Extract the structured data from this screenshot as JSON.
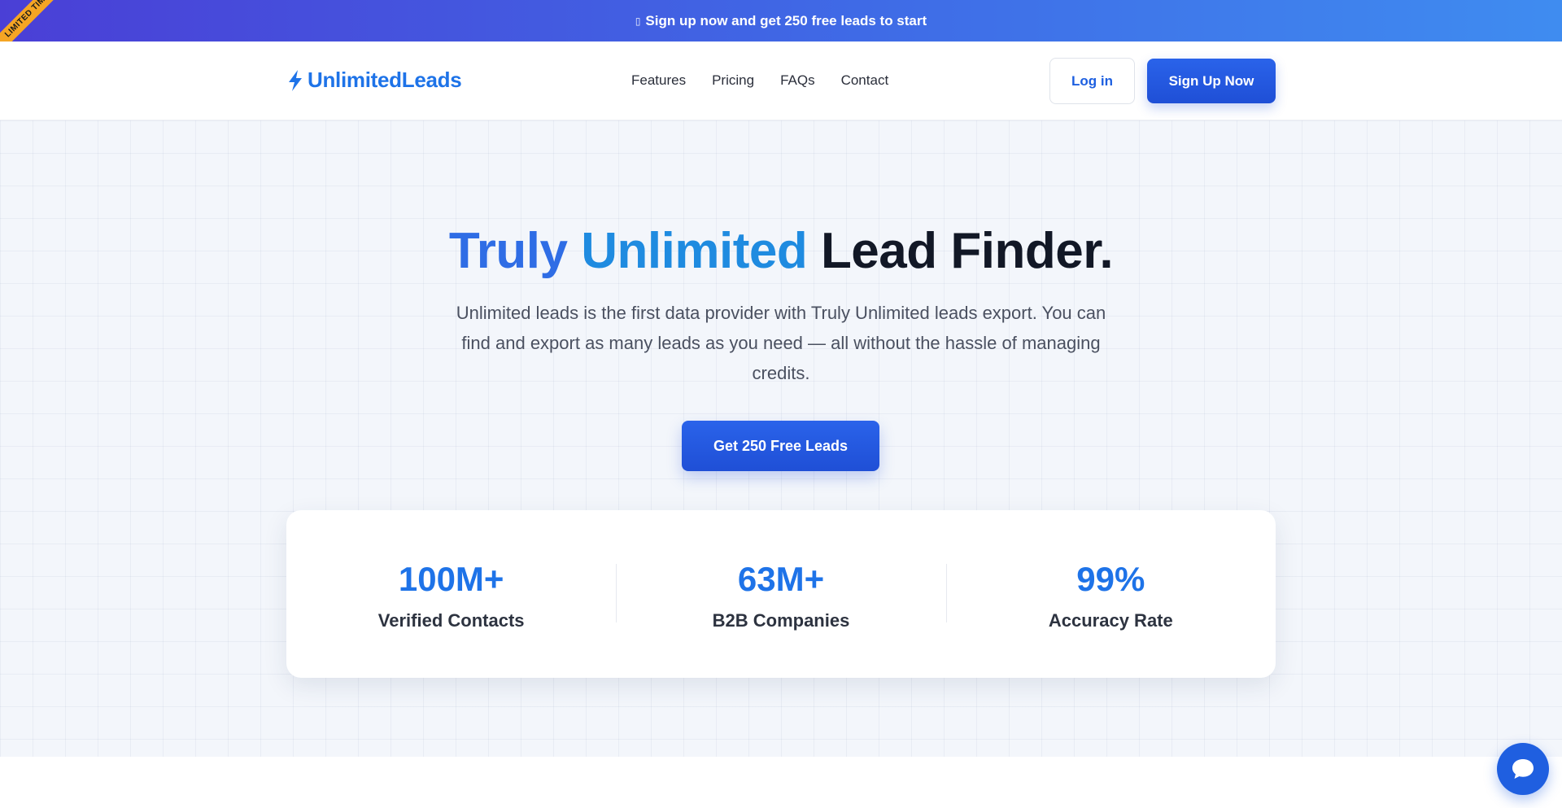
{
  "banner": {
    "ribbon_text": "LIMITED TIME",
    "promo_text": "Sign up now and get 250 free leads to start",
    "promo_icon": "gift-icon"
  },
  "nav": {
    "logo_text": "UnlimitedLeads",
    "logo_icon": "lightning-bolt-icon",
    "links": [
      "Features",
      "Pricing",
      "FAQs",
      "Contact"
    ],
    "login_label": "Log in",
    "signup_label": "Sign Up Now"
  },
  "hero": {
    "title_part1": "Truly",
    "title_part2": "Unlimited",
    "title_part3": "Lead Finder.",
    "subtitle": "Unlimited leads is the first data provider with Truly Unlimited leads export. You can find and export as many leads as you need — all without the hassle of managing credits.",
    "cta_label": "Get 250 Free Leads"
  },
  "stats": [
    {
      "value": "100M+",
      "label": "Verified Contacts"
    },
    {
      "value": "63M+",
      "label": "B2B Companies"
    },
    {
      "value": "99%",
      "label": "Accuracy Rate"
    }
  ],
  "chat": {
    "icon": "chat-bubble-icon"
  },
  "colors": {
    "brand_blue": "#1e73e8",
    "button_blue": "#1f4fd6",
    "ribbon_orange": "#f5a524",
    "title_dark": "#121826"
  }
}
